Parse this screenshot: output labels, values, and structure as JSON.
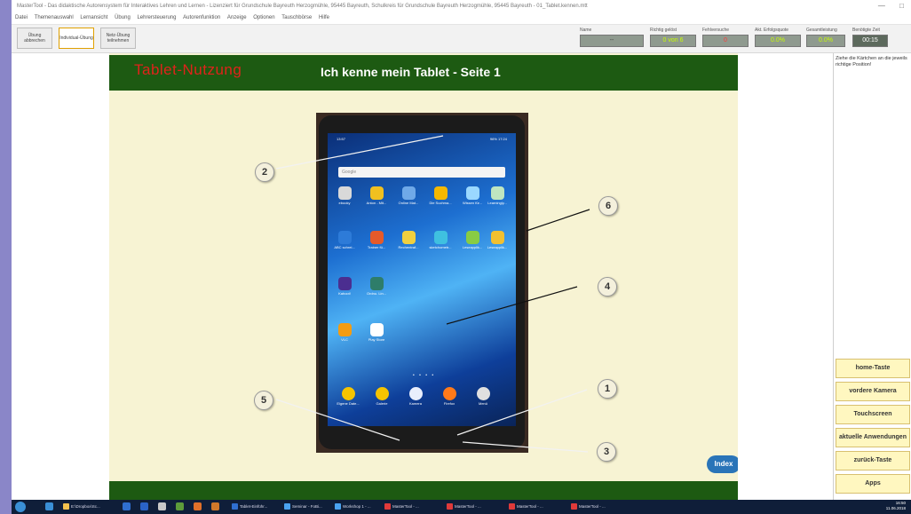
{
  "app": {
    "title": "MasterTool - Das didaktische Autorensystem für Interaktives Lehren und Lernen - Lizenziert für Grundschule Bayreuth Herzogmühle, 95445 Bayreuth, Schulkreis für Grundschule Bayreuth Herzogmühle, 95445 Bayreuth - 01_Tablet.kennen.mtt",
    "win_minimize": "—",
    "win_restore": "□"
  },
  "menu": [
    "Datei",
    "Themenauswahl",
    "Lernansicht",
    "Übung",
    "Lehrersteuerung",
    "Autorenfunktion",
    "Anzeige",
    "Optionen",
    "Tauschbörse",
    "Hilfe"
  ],
  "toolbar": {
    "btn_abbrechen": "Übung abbrechen",
    "btn_individual": "Individual-Übung",
    "btn_netz": "Netz-Übung teilnehmen"
  },
  "stats": {
    "name_label": "Name",
    "name_value": "--",
    "richtig_label": "Richtig gelöst",
    "richtig_value": "0 von 6",
    "fehl_label": "Fehlversuche",
    "fehl_value": "0",
    "erfolg_label": "Akt. Erfolgsquote",
    "erfolg_value": "0.0%",
    "gesamt_label": "Gesamtleistung",
    "gesamt_value": "0.0%",
    "zeit_label": "Benötigte Zeit",
    "zeit_value": "00:15"
  },
  "stage": {
    "brand": "Tablet-Nutzung",
    "title": "Ich kenne mein Tablet - Seite 1",
    "index_button": "Index"
  },
  "tablet": {
    "status_left": "13:57",
    "status_right": "96% 17:24",
    "search_placeholder": "Google",
    "apps": [
      {
        "label": "ebooky",
        "color": "#d9d9d9"
      },
      {
        "label": "Anton - Mit...",
        "color": "#f0c020"
      },
      {
        "label": "Online Mat...",
        "color": "#6fa9e8"
      },
      {
        "label": "Die Suchma...",
        "color": "#f5b800"
      },
      {
        "label": "Wissen für...",
        "color": "#9ad8ff"
      },
      {
        "label": "Learningly...",
        "color": "#bfe6c0"
      },
      {
        "label": "ABC schrei...",
        "color": "#2d7bd8"
      },
      {
        "label": "Trainer fü...",
        "color": "#e55a2a"
      },
      {
        "label": "Rechentraf...",
        "color": "#f0d040"
      },
      {
        "label": "sketchometr...",
        "color": "#3fc0e0"
      },
      {
        "label": "Leseapplik...",
        "color": "#88cc44"
      },
      {
        "label": "Leseapplik...",
        "color": "#f2c030"
      },
      {
        "label": "Kahoot!",
        "color": "#4b2e90"
      },
      {
        "label": "Ordnu. Lin...",
        "color": "#2e7d6a"
      },
      {
        "label": "VLC",
        "color": "#f39c12"
      },
      {
        "label": "Play Store",
        "color": "#ffffff"
      }
    ],
    "dock": [
      {
        "label": "Eigene Date...",
        "color": "#f5c400"
      },
      {
        "label": "Galerie",
        "color": "#f5c400"
      },
      {
        "label": "Kamera",
        "color": "#e9eefc"
      },
      {
        "label": "Firefox",
        "color": "#ff7a1a"
      },
      {
        "label": "Menü",
        "color": "#e0e0e0"
      }
    ],
    "page_dots": "• • • •"
  },
  "callouts": [
    "1",
    "2",
    "3",
    "4",
    "5",
    "6"
  ],
  "sidebar": {
    "instruction": "Ziehe die Kärtchen an die jeweils richtige Position!",
    "cards": [
      "home-Taste",
      "vordere Kamera",
      "Touchscreen",
      "aktuelle Anwendungen",
      "zurück-Taste",
      "Apps"
    ]
  },
  "taskbar": {
    "items": [
      "E:\\Dropbox\\Sc...",
      "Tablet-Einführ...",
      "Seminar - FoBi...",
      "Workshop 1 - ...",
      "MasterTool - ...",
      "MasterTool - ...",
      "MasterTool - ...",
      "MasterTool - ..."
    ],
    "clock_time": "16:50",
    "clock_date": "11.06.2018"
  }
}
